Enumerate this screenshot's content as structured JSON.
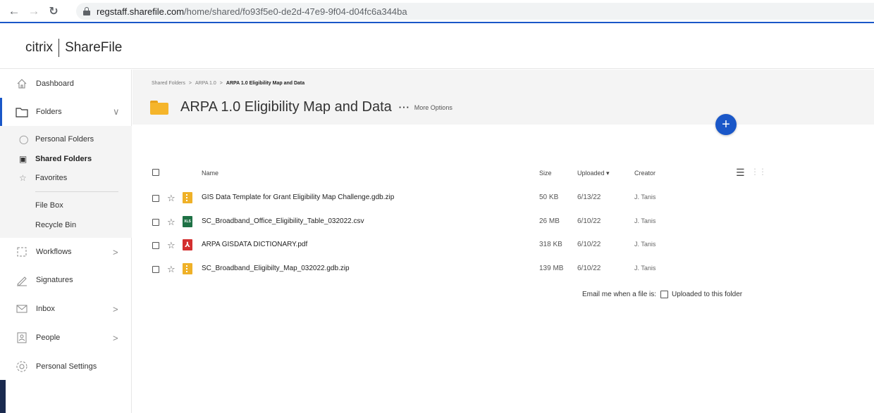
{
  "browser": {
    "url_host": "regstaff.sharefile.com",
    "url_path": "/home/shared/fo93f5e0-de2d-47e9-9f04-d04fc6a344ba",
    "icons": [
      "back-arrow-icon",
      "forward-arrow-icon",
      "reload-icon",
      "lock-icon"
    ]
  },
  "header": {
    "brand_citrix": "citrix",
    "brand_product": "ShareFile"
  },
  "sidebar": {
    "items": [
      {
        "label": "Dashboard",
        "icon": "home-icon"
      },
      {
        "label": "Folders",
        "icon": "folder-icon",
        "active": true
      },
      {
        "label": "Workflows",
        "icon": "workflows-icon"
      },
      {
        "label": "Signatures",
        "icon": "signature-icon"
      },
      {
        "label": "Inbox",
        "icon": "inbox-icon"
      },
      {
        "label": "People",
        "icon": "people-icon"
      },
      {
        "label": "Personal Settings",
        "icon": "gear-icon"
      }
    ],
    "folder_subitems": [
      {
        "label": "Personal Folders",
        "icon": "person-icon"
      },
      {
        "label": "Shared Folders",
        "icon": "shared-folders-icon",
        "selected": true
      },
      {
        "label": "Favorites",
        "icon": "star-icon"
      },
      {
        "label": "File Box"
      },
      {
        "label": "Recycle Bin"
      }
    ]
  },
  "breadcrumb": {
    "items": [
      "Shared Folders",
      "ARPA 1.0",
      "ARPA 1.0 Eligibility Map and Data"
    ],
    "separator": ">"
  },
  "folder": {
    "title": "ARPA 1.0 Eligibility Map and Data",
    "more_options_label": "More Options",
    "more_dots": "···"
  },
  "add_button_symbol": "+",
  "table": {
    "columns": {
      "name": "Name",
      "size": "Size",
      "uploaded": "Uploaded",
      "creator": "Creator"
    },
    "sort_indicator": "▾",
    "rows": [
      {
        "name": "GIS Data Template for Grant Eligibility Map Challenge.gdb.zip",
        "size": "50 KB",
        "uploaded": "6/13/22",
        "creator": "J. Tanis",
        "type": "zip"
      },
      {
        "name": "SC_Broadband_Office_Eligibility_Table_032022.csv",
        "size": "26 MB",
        "uploaded": "6/10/22",
        "creator": "J. Tanis",
        "type": "xls",
        "type_label": "XLS"
      },
      {
        "name": "ARPA GISDATA DICTIONARY.pdf",
        "size": "318 KB",
        "uploaded": "6/10/22",
        "creator": "J. Tanis",
        "type": "pdf",
        "type_label": "⅄"
      },
      {
        "name": "SC_Broadband_Eligibilty_Map_032022.gdb.zip",
        "size": "139 MB",
        "uploaded": "6/10/22",
        "creator": "J. Tanis",
        "type": "zip"
      }
    ]
  },
  "email_notice": {
    "prefix": "Email me when a file is:",
    "option": "Uploaded to this folder"
  },
  "colors": {
    "accent": "#1a57c8",
    "folder": "#f5b52b",
    "xls": "#1e7145",
    "pdf": "#d32f2f",
    "panel_bg": "#f4f4f4"
  }
}
